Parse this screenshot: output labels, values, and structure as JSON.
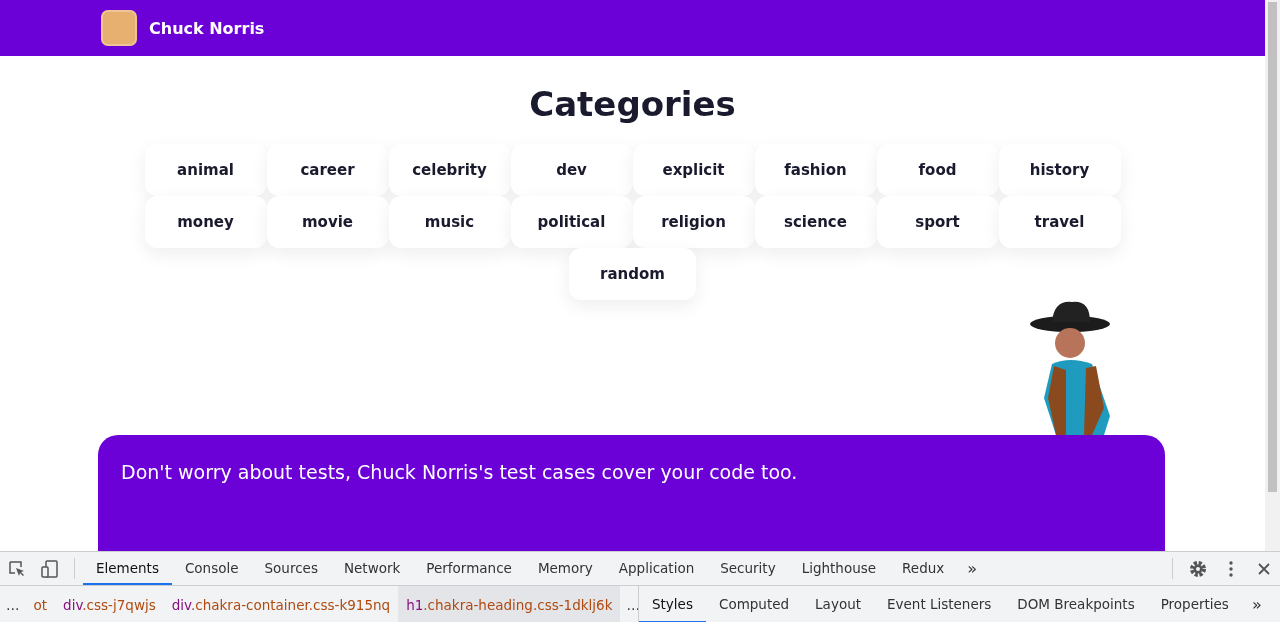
{
  "header": {
    "title": "Chuck Norris"
  },
  "heading": "Categories",
  "categories": [
    "animal",
    "career",
    "celebrity",
    "dev",
    "explicit",
    "fashion",
    "food",
    "history",
    "money",
    "movie",
    "music",
    "political",
    "religion",
    "science",
    "sport",
    "travel",
    "random"
  ],
  "joke": {
    "text": "Don't worry about tests, Chuck Norris's test cases cover your code too."
  },
  "devtools": {
    "tabs": [
      {
        "label": "Elements",
        "selected": true
      },
      {
        "label": "Console",
        "selected": false
      },
      {
        "label": "Sources",
        "selected": false
      },
      {
        "label": "Network",
        "selected": false
      },
      {
        "label": "Performance",
        "selected": false
      },
      {
        "label": "Memory",
        "selected": false
      },
      {
        "label": "Application",
        "selected": false
      },
      {
        "label": "Security",
        "selected": false
      },
      {
        "label": "Lighthouse",
        "selected": false
      },
      {
        "label": "Redux",
        "selected": false
      }
    ],
    "tabs_more": "»",
    "breadcrumbs_lead": "…",
    "breadcrumbs": [
      {
        "cls": "ot",
        "selected": false
      },
      {
        "tag": "div",
        "cls": ".css-j7qwjs",
        "selected": false
      },
      {
        "tag": "div",
        "cls": ".chakra-container.css-k915nq",
        "selected": false
      },
      {
        "tag": "h1",
        "cls": ".chakra-heading.css-1dklj6k",
        "selected": true
      }
    ],
    "breadcrumbs_trail": "…",
    "side_tabs": [
      {
        "label": "Styles",
        "selected": true
      },
      {
        "label": "Computed",
        "selected": false
      },
      {
        "label": "Layout",
        "selected": false
      },
      {
        "label": "Event Listeners",
        "selected": false
      },
      {
        "label": "DOM Breakpoints",
        "selected": false
      },
      {
        "label": "Properties",
        "selected": false
      }
    ],
    "side_tabs_more": "»"
  }
}
